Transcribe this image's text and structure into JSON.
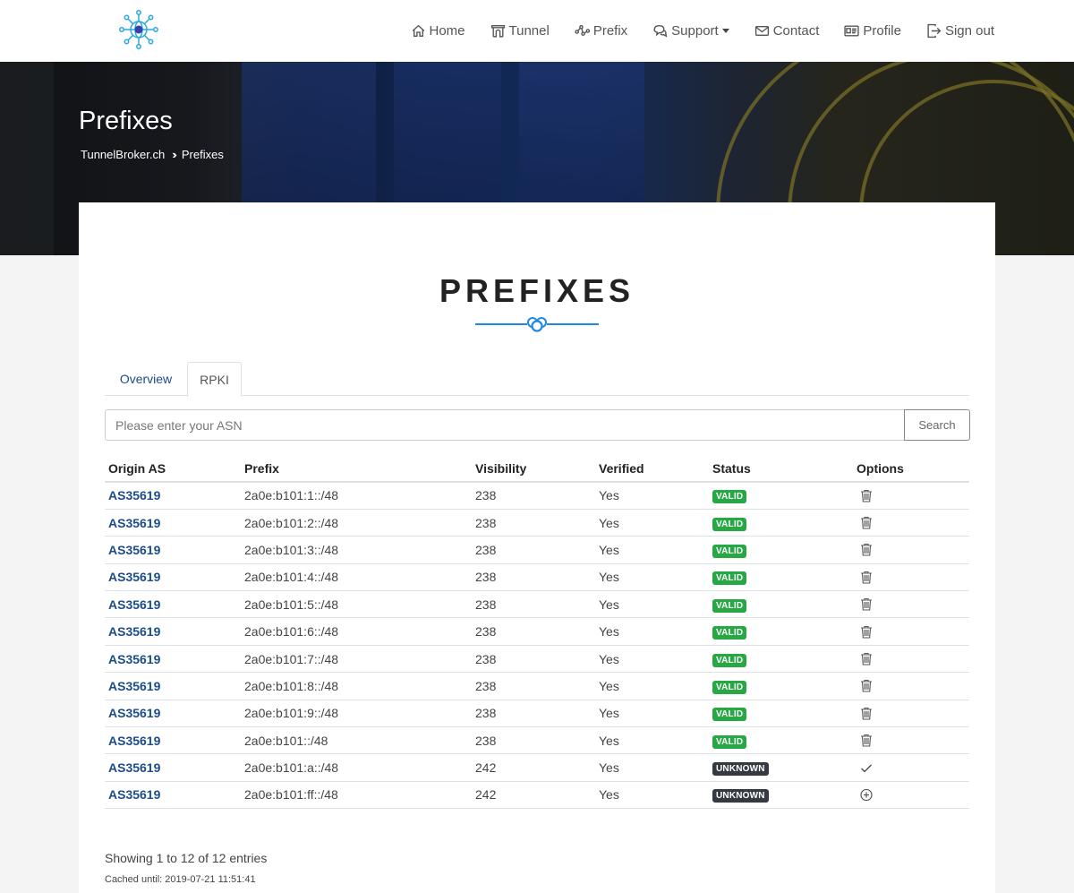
{
  "nav": {
    "items": [
      {
        "label": "Home",
        "icon": "home-icon"
      },
      {
        "label": "Tunnel",
        "icon": "tunnel-icon"
      },
      {
        "label": "Prefix",
        "icon": "prefix-icon"
      },
      {
        "label": "Support",
        "icon": "support-icon"
      },
      {
        "label": "Contact",
        "icon": "contact-icon"
      },
      {
        "label": "Profile",
        "icon": "profile-icon"
      },
      {
        "label": "Sign out",
        "icon": "sign-out-icon"
      }
    ]
  },
  "hero": {
    "title": "Prefixes",
    "breadcrumb_home": "TunnelBroker.ch",
    "breadcrumb_current": "Prefixes"
  },
  "section": {
    "title": "PREFIXES"
  },
  "tabs": [
    {
      "label": "Overview"
    },
    {
      "label": "RPKI"
    }
  ],
  "search": {
    "placeholder": "Please enter your ASN",
    "button": "Search"
  },
  "table": {
    "headers": [
      "Origin AS",
      "Prefix",
      "Visibility",
      "Verified",
      "Status",
      "Options"
    ],
    "rows": [
      {
        "asn": "AS35619",
        "prefix": "2a0e:b101:1::/48",
        "visibility": "238",
        "verified": "Yes",
        "status": "VALID",
        "option": "trash-icon"
      },
      {
        "asn": "AS35619",
        "prefix": "2a0e:b101:2::/48",
        "visibility": "238",
        "verified": "Yes",
        "status": "VALID",
        "option": "trash-icon"
      },
      {
        "asn": "AS35619",
        "prefix": "2a0e:b101:3::/48",
        "visibility": "238",
        "verified": "Yes",
        "status": "VALID",
        "option": "trash-icon"
      },
      {
        "asn": "AS35619",
        "prefix": "2a0e:b101:4::/48",
        "visibility": "238",
        "verified": "Yes",
        "status": "VALID",
        "option": "trash-icon"
      },
      {
        "asn": "AS35619",
        "prefix": "2a0e:b101:5::/48",
        "visibility": "238",
        "verified": "Yes",
        "status": "VALID",
        "option": "trash-icon"
      },
      {
        "asn": "AS35619",
        "prefix": "2a0e:b101:6::/48",
        "visibility": "238",
        "verified": "Yes",
        "status": "VALID",
        "option": "trash-icon"
      },
      {
        "asn": "AS35619",
        "prefix": "2a0e:b101:7::/48",
        "visibility": "238",
        "verified": "Yes",
        "status": "VALID",
        "option": "trash-icon"
      },
      {
        "asn": "AS35619",
        "prefix": "2a0e:b101:8::/48",
        "visibility": "238",
        "verified": "Yes",
        "status": "VALID",
        "option": "trash-icon"
      },
      {
        "asn": "AS35619",
        "prefix": "2a0e:b101:9::/48",
        "visibility": "238",
        "verified": "Yes",
        "status": "VALID",
        "option": "trash-icon"
      },
      {
        "asn": "AS35619",
        "prefix": "2a0e:b101::/48",
        "visibility": "238",
        "verified": "Yes",
        "status": "VALID",
        "option": "trash-icon"
      },
      {
        "asn": "AS35619",
        "prefix": "2a0e:b101:a::/48",
        "visibility": "242",
        "verified": "Yes",
        "status": "UNKNOWN",
        "option": "check-icon"
      },
      {
        "asn": "AS35619",
        "prefix": "2a0e:b101:ff::/48",
        "visibility": "242",
        "verified": "Yes",
        "status": "UNKNOWN",
        "option": "plus-circle-icon"
      }
    ]
  },
  "footer": {
    "showing": "Showing 1 to 12 of 12 entries",
    "cached": "Cached until: 2019-07-21 11:51:41"
  },
  "colors": {
    "link": "#1b4d8c",
    "valid": "#28a745",
    "unknown": "#343a40",
    "accent": "#1e88e5"
  }
}
